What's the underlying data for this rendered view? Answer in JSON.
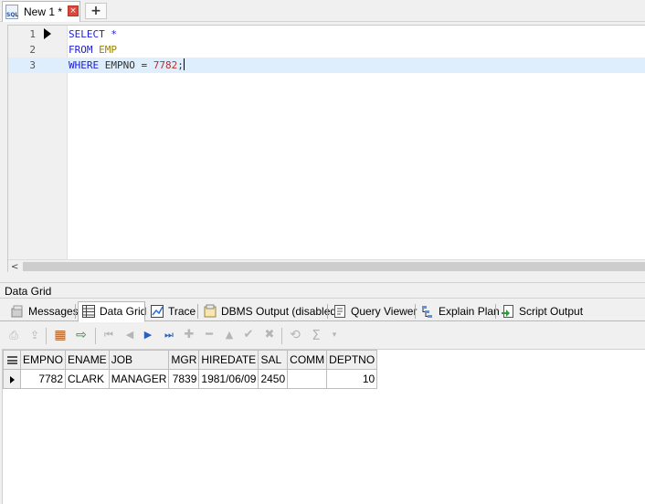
{
  "document_tab": {
    "icon": "sql-file-icon",
    "icon_text": "SQL",
    "label": "New 1 *",
    "close_glyph": "×",
    "new_tab_glyph": "+"
  },
  "editor": {
    "lines": [
      {
        "number": "1",
        "tokens": [
          {
            "text": "SELECT",
            "class": "kw"
          },
          {
            "text": " *",
            "class": "kw"
          }
        ]
      },
      {
        "number": "2",
        "tokens": [
          {
            "text": "FROM",
            "class": "kw"
          },
          {
            "text": " EMP",
            "class": "tbl"
          }
        ]
      },
      {
        "number": "3",
        "tokens": [
          {
            "text": "WHERE",
            "class": "kw"
          },
          {
            "text": " EMPNO ",
            "class": "op"
          },
          {
            "text": "=",
            "class": "op"
          },
          {
            "text": " 7782",
            "class": "num"
          },
          {
            "text": ";",
            "class": "op"
          }
        ]
      }
    ],
    "current_line": 3,
    "scroll_left_glyph": "<"
  },
  "panel": {
    "title": "Data Grid",
    "tabs": [
      {
        "label": "Messages",
        "icon": "messages-icon",
        "active": false
      },
      {
        "label": "Data Grid",
        "icon": "data-grid-icon",
        "active": true
      },
      {
        "label": "Trace",
        "icon": "trace-icon",
        "active": false
      },
      {
        "label": "DBMS Output (disabled)",
        "icon": "dbms-output-icon",
        "active": false
      },
      {
        "label": "Query Viewer",
        "icon": "query-viewer-icon",
        "active": false
      },
      {
        "label": "Explain Plan",
        "icon": "explain-plan-icon",
        "active": false
      },
      {
        "label": "Script Output",
        "icon": "script-output-icon",
        "active": false
      }
    ]
  },
  "grid_toolbar": [
    {
      "name": "print-icon",
      "glyph": "⎙",
      "enabled": false
    },
    {
      "name": "export-icon",
      "glyph": "⇪",
      "enabled": false
    },
    {
      "name": "grid-layout-icon",
      "glyph": "▦",
      "enabled": true
    },
    {
      "name": "export-data-icon",
      "glyph": "⇨",
      "enabled": true
    },
    {
      "name": "first-record-icon",
      "glyph": "⏮",
      "enabled": false
    },
    {
      "name": "prior-record-icon",
      "glyph": "◀",
      "enabled": false
    },
    {
      "name": "next-record-icon",
      "glyph": "▶",
      "enabled": true
    },
    {
      "name": "last-record-icon",
      "glyph": "⏭",
      "enabled": true
    },
    {
      "name": "insert-record-icon",
      "glyph": "✚",
      "enabled": false
    },
    {
      "name": "delete-record-icon",
      "glyph": "━",
      "enabled": false
    },
    {
      "name": "edit-record-icon",
      "glyph": "▲",
      "enabled": false
    },
    {
      "name": "post-edit-icon",
      "glyph": "✔",
      "enabled": false
    },
    {
      "name": "cancel-edit-icon",
      "glyph": "✖",
      "enabled": false
    },
    {
      "name": "refresh-icon",
      "glyph": "⟲",
      "enabled": false
    },
    {
      "name": "sum-icon",
      "glyph": "Σ",
      "enabled": false
    },
    {
      "name": "sum-dropdown-icon",
      "glyph": "▾",
      "enabled": false
    }
  ],
  "grid": {
    "columns": [
      "EMPNO",
      "ENAME",
      "JOB",
      "MGR",
      "HIREDATE",
      "SAL",
      "COMM",
      "DEPTNO"
    ],
    "rows": [
      [
        "7782",
        "CLARK",
        "MANAGER",
        "7839",
        "1981/06/09",
        "2450",
        "",
        "10"
      ]
    ]
  },
  "colors": {
    "keyword": "#1c1cd8",
    "table_name": "#9a8200",
    "number": "#b03030",
    "current_line": "#deeefc"
  }
}
